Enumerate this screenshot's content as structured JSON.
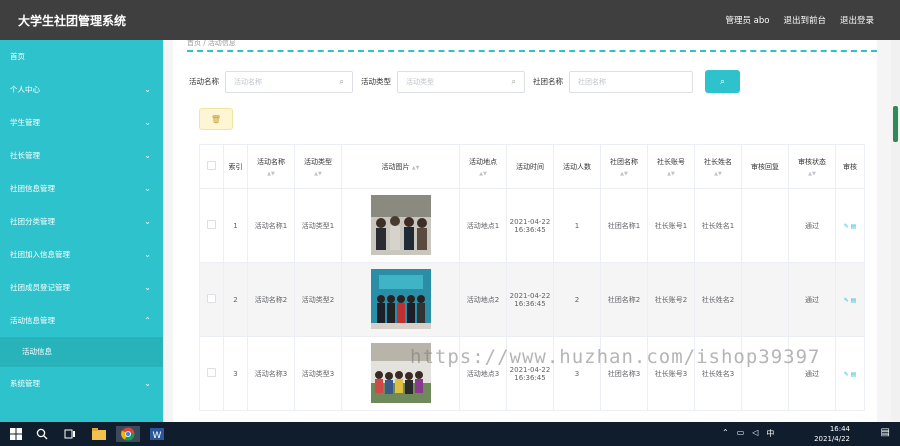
{
  "header": {
    "title": "大学生社团管理系统",
    "admin": "管理员 abo",
    "back_front": "退出到前台",
    "logout": "退出登录"
  },
  "sidebar": {
    "items": [
      {
        "label": "首页",
        "chevron": ""
      },
      {
        "label": "个人中心",
        "chevron": "⌄"
      },
      {
        "label": "学生管理",
        "chevron": "⌄"
      },
      {
        "label": "社长管理",
        "chevron": "⌄"
      },
      {
        "label": "社团信息管理",
        "chevron": "⌄"
      },
      {
        "label": "社团分类管理",
        "chevron": "⌄"
      },
      {
        "label": "社团加入信息管理",
        "chevron": "⌄"
      },
      {
        "label": "社团成员登记管理",
        "chevron": "⌄"
      },
      {
        "label": "活动信息管理",
        "chevron": "⌃"
      },
      {
        "label": "活动信息",
        "chevron": ""
      },
      {
        "label": "系统管理",
        "chevron": "⌄"
      }
    ]
  },
  "breadcrumb": "首页 / 活动信息",
  "search": {
    "activity_name_label": "活动名称",
    "activity_name_placeholder": "活动名称",
    "activity_type_label": "活动类型",
    "activity_type_placeholder": "活动类型",
    "club_name_label": "社团名称",
    "club_name_placeholder": "社团名称",
    "search_icon": "⌕"
  },
  "delete_icon": "🗑",
  "table": {
    "headers": {
      "index": "索引",
      "name": "活动名称",
      "type": "活动类型",
      "image": "活动图片",
      "place": "活动地点",
      "time": "活动时间",
      "people": "活动人数",
      "club": "社团名称",
      "leader_acct": "社长账号",
      "leader_name": "社长姓名",
      "reply": "审核回复",
      "status": "审核状态",
      "audit": "审核"
    },
    "sort_icon": "▲▼",
    "rows": [
      {
        "index": "1",
        "name": "活动名称1",
        "type": "活动类型1",
        "place": "活动地点1",
        "time": "2021-04-22 16:36:45",
        "people": "1",
        "club": "社团名称1",
        "leader_acct": "社长账号1",
        "leader_name": "社长姓名1",
        "reply": "",
        "status": "通过",
        "ops": "✎ ▤"
      },
      {
        "index": "2",
        "name": "活动名称2",
        "type": "活动类型2",
        "place": "活动地点2",
        "time": "2021-04-22 16:36:45",
        "people": "2",
        "club": "社团名称2",
        "leader_acct": "社长账号2",
        "leader_name": "社长姓名2",
        "reply": "",
        "status": "通过",
        "ops": "✎ ▤"
      },
      {
        "index": "3",
        "name": "活动名称3",
        "type": "活动类型3",
        "place": "活动地点3",
        "time": "2021-04-22 16:36:45",
        "people": "3",
        "club": "社团名称3",
        "leader_acct": "社长账号3",
        "leader_name": "社长姓名3",
        "reply": "",
        "status": "通过",
        "ops": "✎ ▤"
      }
    ]
  },
  "watermark": "https://www.huzhan.com/ishop39397",
  "taskbar": {
    "time": "16:44",
    "date": "2021/4/22",
    "ime": "中"
  },
  "colors": {
    "accent": "#2ec3cc",
    "header_bg": "#3f3f3f",
    "taskbar_bg": "#0f1d2c"
  }
}
